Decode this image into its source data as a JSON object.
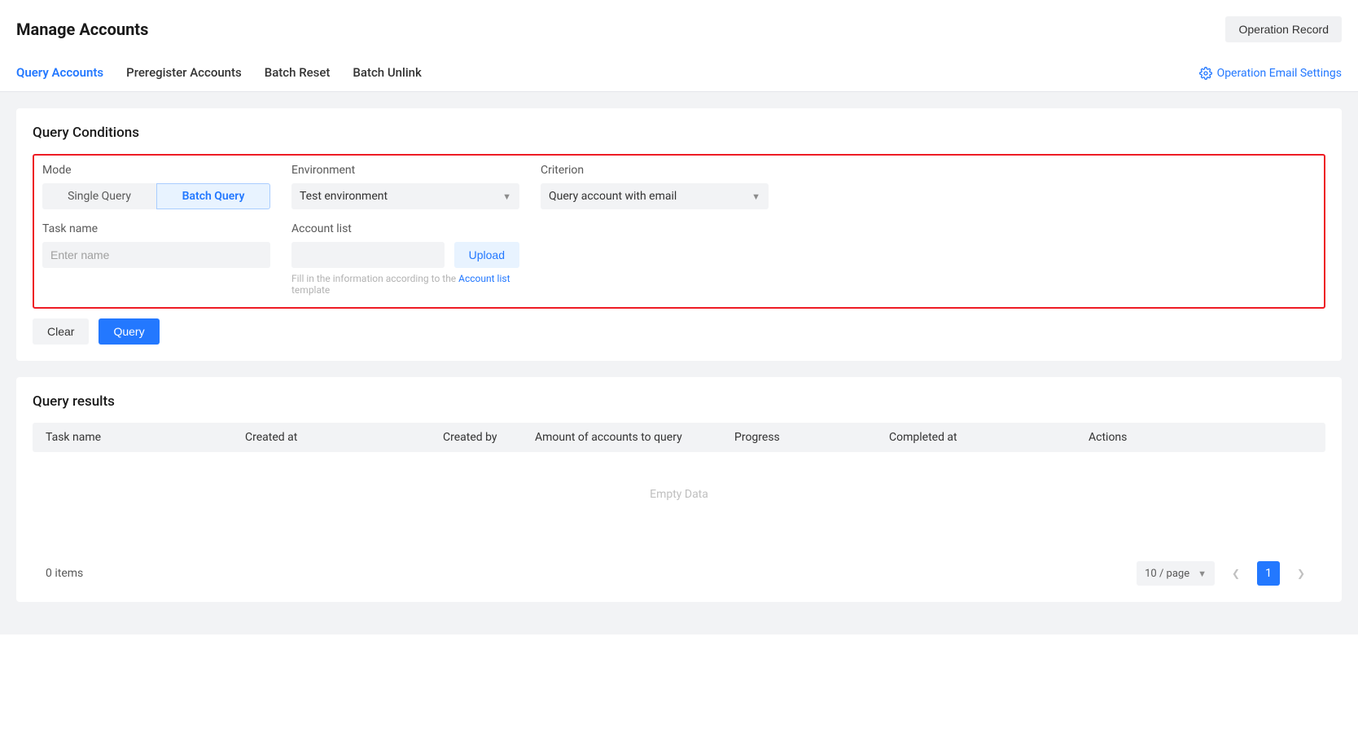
{
  "header": {
    "title": "Manage Accounts",
    "operation_record": "Operation Record"
  },
  "tabs": {
    "items": [
      "Query Accounts",
      "Preregister Accounts",
      "Batch Reset",
      "Batch Unlink"
    ],
    "email_settings": "Operation Email Settings"
  },
  "conditions": {
    "title": "Query Conditions",
    "mode": {
      "label": "Mode",
      "options": [
        "Single Query",
        "Batch Query"
      ]
    },
    "environment": {
      "label": "Environment",
      "value": "Test environment"
    },
    "criterion": {
      "label": "Criterion",
      "value": "Query account with email"
    },
    "task_name": {
      "label": "Task name",
      "placeholder": "Enter name"
    },
    "account_list": {
      "label": "Account list",
      "upload": "Upload",
      "hint_prefix": "Fill in the information according to the ",
      "hint_link": "Account list",
      "hint_suffix": " template"
    },
    "actions": {
      "clear": "Clear",
      "query": "Query"
    }
  },
  "results": {
    "title": "Query results",
    "columns": {
      "task_name": "Task name",
      "created_at": "Created at",
      "created_by": "Created by",
      "amount": "Amount of accounts to query",
      "progress": "Progress",
      "completed_at": "Completed at",
      "actions": "Actions"
    },
    "empty": "Empty Data",
    "footer": {
      "items": "0 items",
      "page_size": "10 / page",
      "current_page": "1"
    }
  }
}
